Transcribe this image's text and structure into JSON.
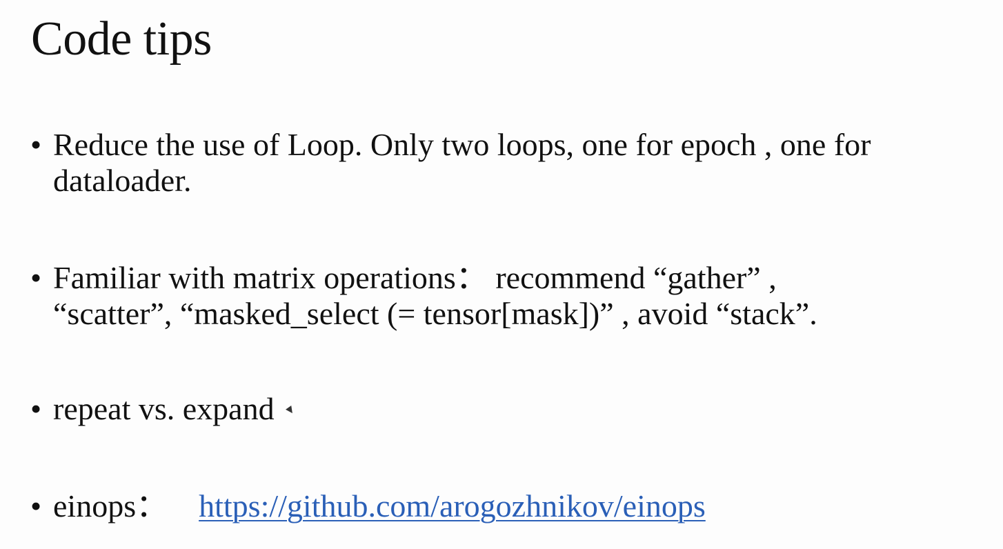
{
  "slide": {
    "title": "Code tips",
    "bullet_glyph": "•",
    "bullets": [
      {
        "line1": "Reduce the use of Loop. Only two loops, one for epoch , one for",
        "line2": "dataloader."
      },
      {
        "line1": "Familiar with matrix operations： recommend “gather” ,",
        "line2": "“scatter”, “masked_select (= tensor[mask])” , avoid “stack”."
      },
      {
        "line1": "repeat vs. expand"
      },
      {
        "label": "einops：",
        "link_text": "https://github.com/arogozhnikov/einops"
      }
    ]
  },
  "colors": {
    "background": "#fdfdfd",
    "text": "#111111",
    "link": "#2a5fb7"
  }
}
